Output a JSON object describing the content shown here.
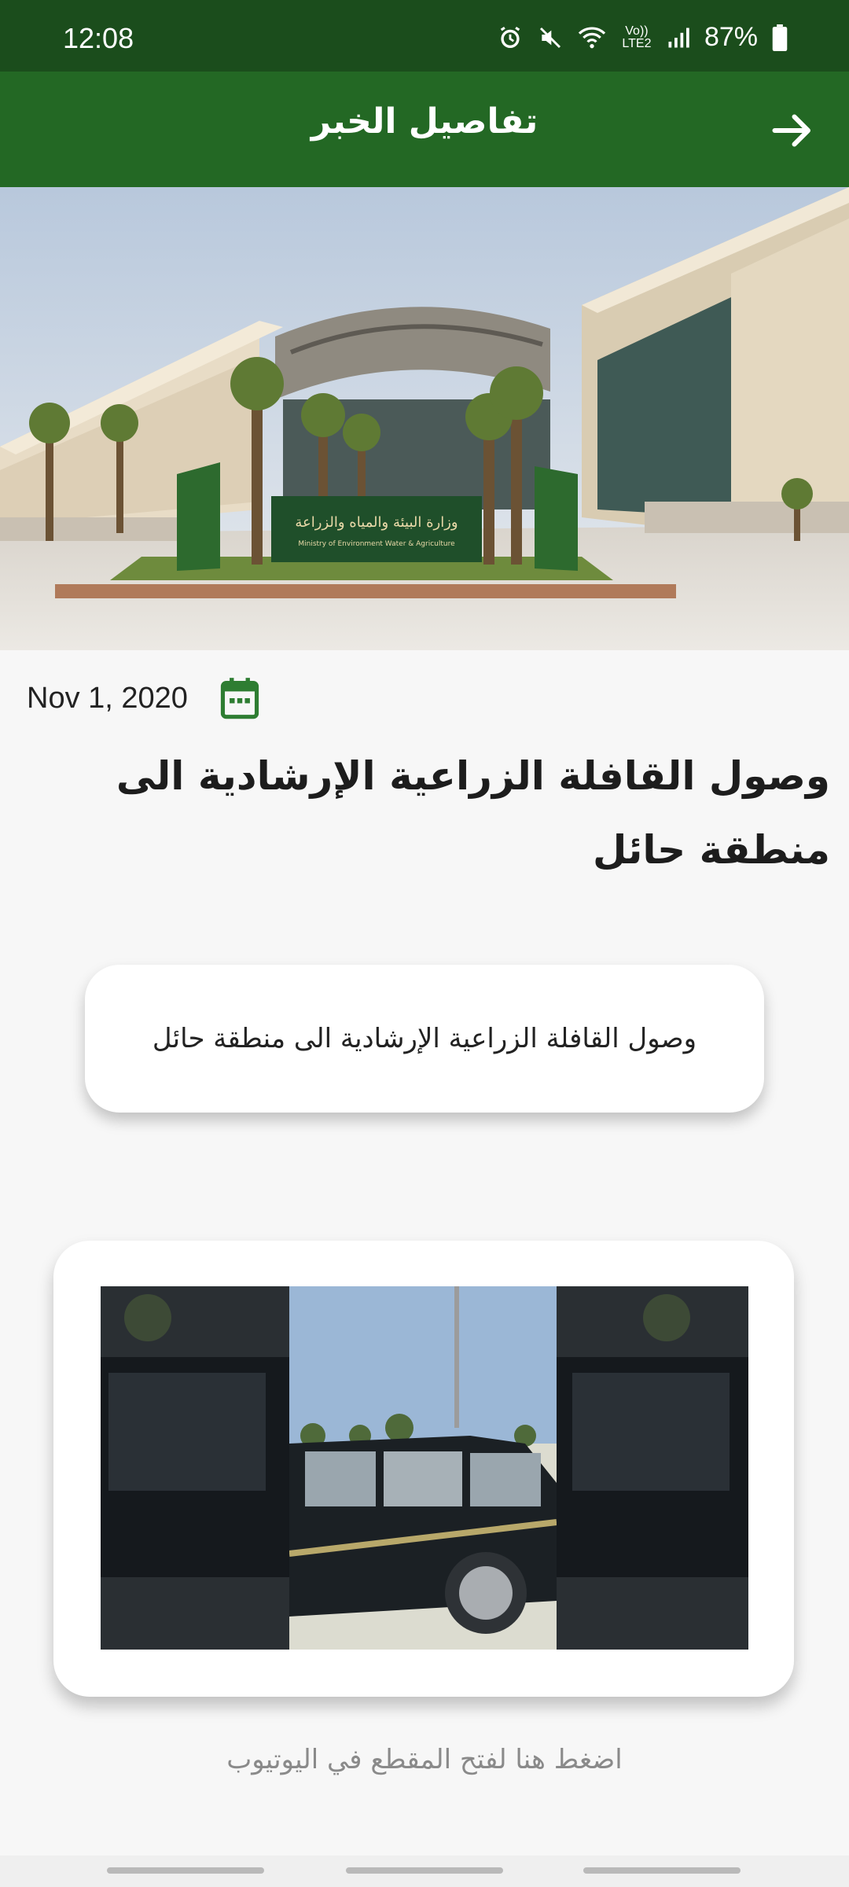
{
  "status_bar": {
    "time": "12:08",
    "battery": "87%",
    "network": "Vo)) LTE2",
    "icons": [
      "alarm-icon",
      "mute-icon",
      "wifi-icon",
      "signal-icon",
      "battery-icon"
    ]
  },
  "app_bar": {
    "title": "تفاصيل الخبر",
    "back_icon": "arrow-right-icon"
  },
  "hero": {
    "image": "ministry-building-photo",
    "sign_text": "وزارة البيئة والمياه والزراعة",
    "sign_subtext": "Ministry of Environment Water & Agriculture"
  },
  "article": {
    "date": "Nov 1, 2020",
    "title": "وصول القافلة الزراعية الإرشادية الى منطقة حائل",
    "summary": "وصول القافلة الزراعية الإرشادية الى منطقة حائل"
  },
  "video": {
    "thumbnail": "vehicle-video-thumbnail",
    "hint": "اضغط هنا لفتح المقطع في اليوتيوب"
  },
  "colors": {
    "status_bar": "#1b4d1c",
    "app_bar": "#236824",
    "accent": "#2e7d32"
  }
}
